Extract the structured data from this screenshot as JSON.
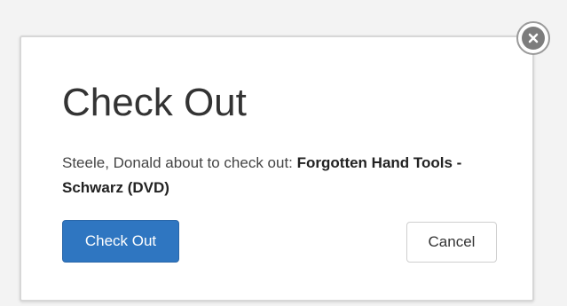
{
  "dialog": {
    "title": "Check Out",
    "message_prefix": "Steele, Donald about to check out: ",
    "item_title": "Forgotten Hand Tools - Schwarz (DVD)",
    "close_icon": "close-icon",
    "primary_button_label": "Check Out",
    "cancel_button_label": "Cancel"
  },
  "colors": {
    "primary": "#2f76c1",
    "text": "#333333",
    "close_icon": "#7d7d7d"
  }
}
